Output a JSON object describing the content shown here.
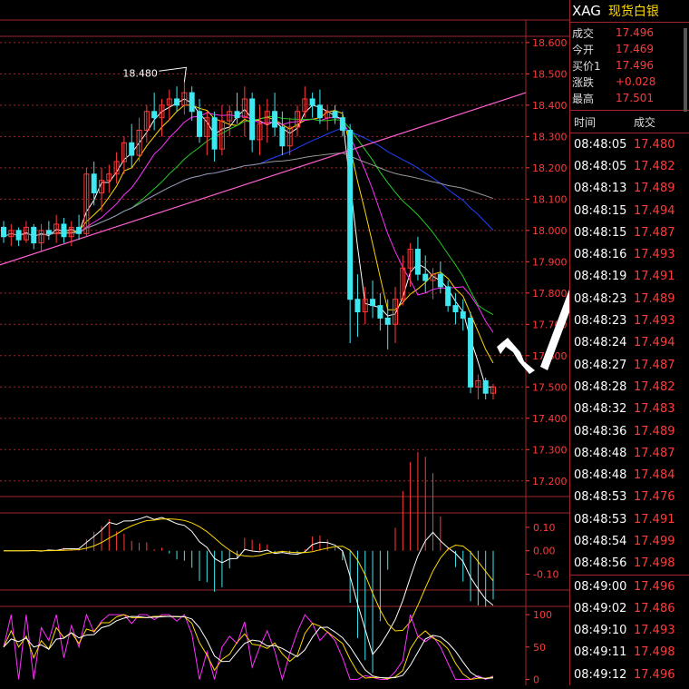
{
  "symbol": {
    "code": "XAG",
    "name": "现货白银"
  },
  "quote": [
    {
      "label": "成交",
      "value": "17.496"
    },
    {
      "label": "今开",
      "value": "17.469"
    },
    {
      "label": "买价1",
      "value": "17.496"
    },
    {
      "label": "涨跌",
      "value": "+0.028"
    },
    {
      "label": "最高",
      "value": "17.501"
    }
  ],
  "trades_header": {
    "time": "时间",
    "price": "成交"
  },
  "trades": [
    {
      "time": "08:48:05",
      "price": "17.480"
    },
    {
      "time": "08:48:05",
      "price": "17.482"
    },
    {
      "time": "08:48:13",
      "price": "17.489"
    },
    {
      "time": "08:48:15",
      "price": "17.494"
    },
    {
      "time": "08:48:15",
      "price": "17.487"
    },
    {
      "time": "08:48:16",
      "price": "17.493"
    },
    {
      "time": "08:48:19",
      "price": "17.491"
    },
    {
      "time": "08:48:23",
      "price": "17.489"
    },
    {
      "time": "08:48:23",
      "price": "17.493"
    },
    {
      "time": "08:48:24",
      "price": "17.494"
    },
    {
      "time": "08:48:27",
      "price": "17.487"
    },
    {
      "time": "08:48:28",
      "price": "17.482"
    },
    {
      "time": "08:48:32",
      "price": "17.483"
    },
    {
      "time": "08:48:36",
      "price": "17.489"
    },
    {
      "time": "08:48:48",
      "price": "17.487"
    },
    {
      "time": "08:48:48",
      "price": "17.484"
    },
    {
      "time": "08:48:53",
      "price": "17.476"
    },
    {
      "time": "08:48:53",
      "price": "17.491"
    },
    {
      "time": "08:48:54",
      "price": "17.499"
    },
    {
      "time": "08:48:56",
      "price": "17.498"
    },
    {
      "time": "08:49:00",
      "price": "17.496"
    },
    {
      "time": "08:49:02",
      "price": "17.486"
    },
    {
      "time": "08:49:10",
      "price": "17.493"
    },
    {
      "time": "08:49:11",
      "price": "17.498"
    },
    {
      "time": "08:49:12",
      "price": "17.496"
    }
  ],
  "colors": {
    "up": "#ff3b3b",
    "down": "#3ee8f0",
    "grid": "#a0262b",
    "axis": "#ff3b3b"
  },
  "chart_data": [
    {
      "type": "line",
      "note": "candlestick price chart",
      "y_ticks": [
        "18.600",
        "18.500",
        "18.400",
        "18.300",
        "18.200",
        "18.100",
        "18.000",
        "17.900",
        "17.800",
        "17.700",
        "17.600",
        "17.500",
        "17.400",
        "17.300",
        "17.200"
      ],
      "ylim": [
        17.15,
        18.62
      ],
      "annotation": "18.480",
      "candles": [
        [
          18.01,
          18.03,
          17.96,
          17.98
        ],
        [
          17.98,
          18.02,
          17.95,
          18.0
        ],
        [
          18.0,
          18.01,
          17.95,
          17.97
        ],
        [
          17.97,
          18.03,
          17.96,
          18.01
        ],
        [
          18.01,
          18.02,
          17.94,
          17.96
        ],
        [
          17.96,
          18.02,
          17.93,
          18.0
        ],
        [
          18.0,
          18.03,
          17.97,
          17.99
        ],
        [
          17.99,
          18.05,
          17.96,
          18.02
        ],
        [
          18.02,
          18.04,
          17.96,
          17.98
        ],
        [
          17.98,
          18.03,
          17.95,
          18.01
        ],
        [
          18.01,
          18.05,
          17.97,
          17.99
        ],
        [
          17.99,
          18.2,
          17.98,
          18.18
        ],
        [
          18.18,
          18.22,
          18.08,
          18.12
        ],
        [
          18.12,
          18.2,
          18.06,
          18.16
        ],
        [
          18.16,
          18.21,
          18.12,
          18.18
        ],
        [
          18.18,
          18.25,
          18.15,
          18.22
        ],
        [
          18.22,
          18.3,
          18.18,
          18.28
        ],
        [
          18.28,
          18.34,
          18.2,
          18.24
        ],
        [
          18.24,
          18.36,
          18.22,
          18.32
        ],
        [
          18.32,
          18.4,
          18.28,
          18.38
        ],
        [
          18.38,
          18.44,
          18.32,
          18.36
        ],
        [
          18.36,
          18.42,
          18.3,
          18.4
        ],
        [
          18.4,
          18.45,
          18.35,
          18.42
        ],
        [
          18.42,
          18.46,
          18.38,
          18.4
        ],
        [
          18.4,
          18.48,
          18.37,
          18.44
        ],
        [
          18.44,
          18.46,
          18.35,
          18.38
        ],
        [
          18.38,
          18.42,
          18.28,
          18.3
        ],
        [
          18.3,
          18.38,
          18.24,
          18.36
        ],
        [
          18.36,
          18.38,
          18.22,
          18.26
        ],
        [
          18.26,
          18.4,
          18.24,
          18.35
        ],
        [
          18.35,
          18.4,
          18.3,
          18.38
        ],
        [
          18.38,
          18.44,
          18.34,
          18.36
        ],
        [
          18.36,
          18.46,
          18.3,
          18.42
        ],
        [
          18.42,
          18.44,
          18.25,
          18.29
        ],
        [
          18.29,
          18.4,
          18.24,
          18.34
        ],
        [
          18.34,
          18.42,
          18.28,
          18.38
        ],
        [
          18.38,
          18.44,
          18.3,
          18.33
        ],
        [
          18.33,
          18.38,
          18.24,
          18.27
        ],
        [
          18.27,
          18.36,
          18.24,
          18.33
        ],
        [
          18.33,
          18.4,
          18.3,
          18.38
        ],
        [
          18.38,
          18.46,
          18.36,
          18.42
        ],
        [
          18.42,
          18.44,
          18.36,
          18.4
        ],
        [
          18.4,
          18.45,
          18.34,
          18.36
        ],
        [
          18.36,
          18.4,
          18.32,
          18.38
        ],
        [
          18.38,
          18.4,
          18.34,
          18.36
        ],
        [
          18.36,
          18.38,
          18.3,
          18.32
        ],
        [
          18.32,
          18.34,
          17.64,
          17.78
        ],
        [
          17.78,
          17.86,
          17.66,
          17.74
        ],
        [
          17.74,
          17.82,
          17.7,
          17.78
        ],
        [
          17.78,
          17.84,
          17.72,
          17.76
        ],
        [
          17.76,
          17.8,
          17.68,
          17.72
        ],
        [
          17.72,
          17.78,
          17.62,
          17.7
        ],
        [
          17.7,
          17.82,
          17.64,
          17.78
        ],
        [
          17.78,
          17.92,
          17.76,
          17.88
        ],
        [
          17.88,
          17.96,
          17.82,
          17.94
        ],
        [
          17.94,
          17.98,
          17.84,
          17.86
        ],
        [
          17.86,
          17.92,
          17.8,
          17.84
        ],
        [
          17.84,
          17.88,
          17.78,
          17.86
        ],
        [
          17.86,
          17.9,
          17.8,
          17.82
        ],
        [
          17.82,
          17.84,
          17.74,
          17.76
        ],
        [
          17.76,
          17.8,
          17.7,
          17.74
        ],
        [
          17.74,
          17.78,
          17.68,
          17.72
        ],
        [
          17.72,
          17.74,
          17.48,
          17.5
        ],
        [
          17.5,
          17.54,
          17.46,
          17.52
        ],
        [
          17.52,
          17.53,
          17.46,
          17.48
        ],
        [
          17.48,
          17.51,
          17.46,
          17.5
        ]
      ]
    },
    {
      "type": "line",
      "note": "MACD panel",
      "y_ticks": [
        "0.10",
        "0.00",
        "-0.10"
      ],
      "ylim": [
        -0.16,
        0.15
      ]
    },
    {
      "type": "line",
      "note": "oscillator panel",
      "y_ticks": [
        "100",
        "50",
        "0"
      ],
      "ylim": [
        -5,
        110
      ]
    }
  ]
}
